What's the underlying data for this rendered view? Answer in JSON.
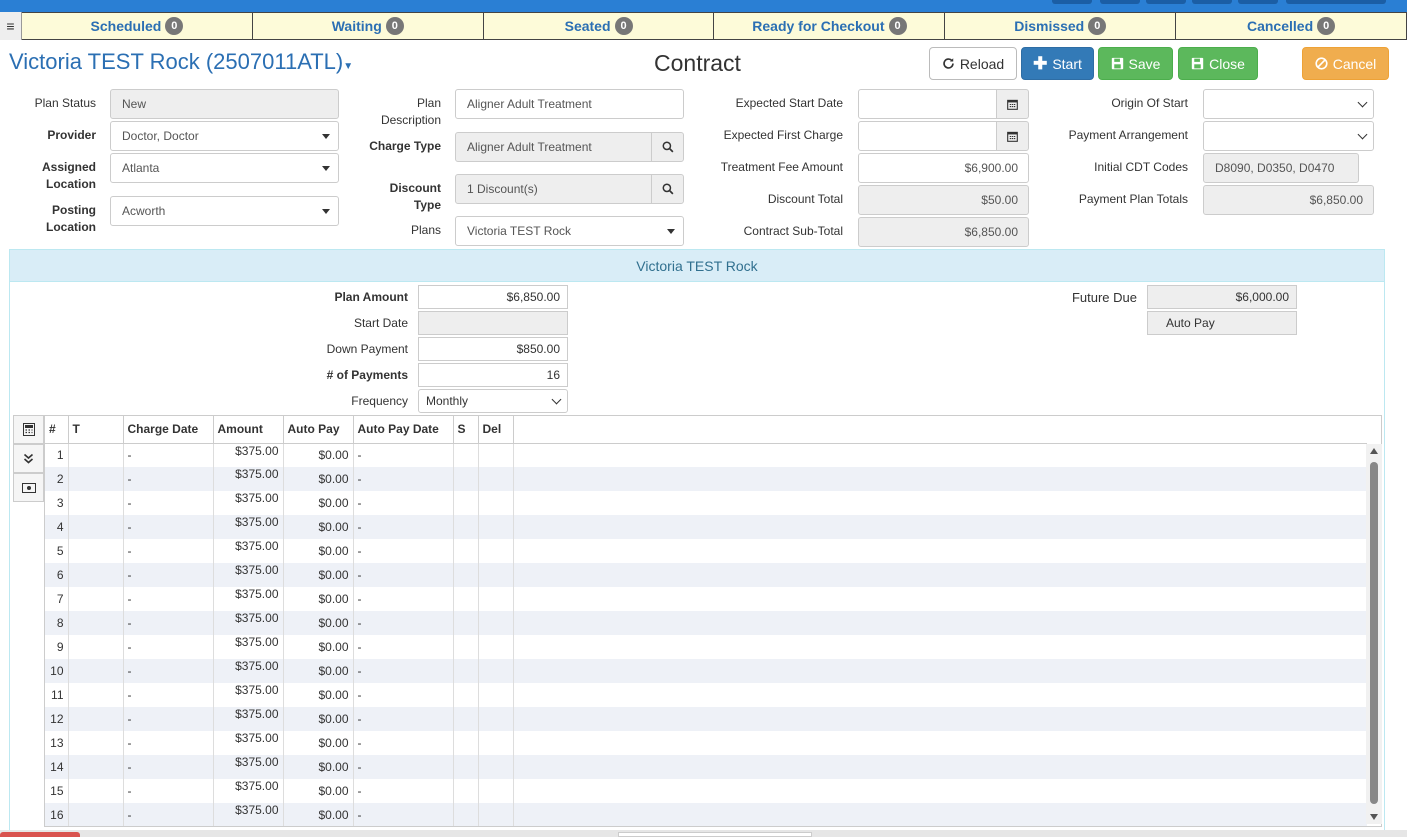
{
  "statusbar": {
    "tabs": [
      {
        "label": "Scheduled",
        "count": "0"
      },
      {
        "label": "Waiting",
        "count": "0"
      },
      {
        "label": "Seated",
        "count": "0"
      },
      {
        "label": "Ready for Checkout",
        "count": "0"
      },
      {
        "label": "Dismissed",
        "count": "0"
      },
      {
        "label": "Cancelled",
        "count": "0"
      }
    ]
  },
  "header": {
    "patient": "Victoria TEST Rock (2507011ATL)",
    "title": "Contract",
    "buttons": {
      "reload": "Reload",
      "start": "Start",
      "save": "Save",
      "close": "Close",
      "cancel": "Cancel"
    }
  },
  "form": {
    "plan_status": {
      "label": "Plan Status",
      "value": "New"
    },
    "provider": {
      "label": "Provider",
      "value": "Doctor, Doctor"
    },
    "assigned_location": {
      "label": "Assigned Location",
      "value": "Atlanta"
    },
    "posting_location": {
      "label": "Posting Location",
      "value": "Acworth"
    },
    "plan_description": {
      "label": "Plan Description",
      "value": "Aligner Adult Treatment"
    },
    "charge_type": {
      "label": "Charge Type",
      "value": "Aligner Adult Treatment"
    },
    "discount_type": {
      "label": "Discount Type",
      "value": "1 Discount(s)"
    },
    "plans": {
      "label": "Plans",
      "value": "Victoria TEST Rock"
    },
    "expected_start_date": {
      "label": "Expected Start Date",
      "value": ""
    },
    "expected_first_charge": {
      "label": "Expected First Charge",
      "value": ""
    },
    "treatment_fee_amount": {
      "label": "Treatment Fee Amount",
      "value": "$6,900.00"
    },
    "discount_total": {
      "label": "Discount Total",
      "value": "$50.00"
    },
    "contract_subtotal": {
      "label": "Contract Sub-Total",
      "value": "$6,850.00"
    },
    "origin_of_start": {
      "label": "Origin Of Start",
      "value": ""
    },
    "payment_arrangement": {
      "label": "Payment Arrangement",
      "value": ""
    },
    "initial_cdt_codes": {
      "label": "Initial CDT Codes",
      "value": "D8090, D0350, D0470"
    },
    "payment_plan_totals": {
      "label": "Payment Plan Totals",
      "value": "$6,850.00"
    }
  },
  "plan_panel": {
    "title": "Victoria TEST Rock",
    "plan_amount": {
      "label": "Plan Amount",
      "value": "$6,850.00"
    },
    "start_date": {
      "label": "Start Date",
      "value": ""
    },
    "down_payment": {
      "label": "Down Payment",
      "value": "$850.00"
    },
    "num_payments": {
      "label": "# of Payments",
      "value": "16"
    },
    "frequency": {
      "label": "Frequency",
      "value": "Monthly"
    },
    "future_due": {
      "label": "Future Due",
      "value": "$6,000.00"
    },
    "auto_pay_button": "Auto Pay"
  },
  "schedule": {
    "columns": [
      "#",
      "T",
      "Charge Date",
      "Amount",
      "Auto Pay",
      "Auto Pay Date",
      "S",
      "Del"
    ],
    "rows": [
      {
        "n": "1",
        "date": "-",
        "amount": "$375.00",
        "autopay": "$0.00",
        "apdate": "-"
      },
      {
        "n": "2",
        "date": "-",
        "amount": "$375.00",
        "autopay": "$0.00",
        "apdate": "-"
      },
      {
        "n": "3",
        "date": "-",
        "amount": "$375.00",
        "autopay": "$0.00",
        "apdate": "-"
      },
      {
        "n": "4",
        "date": "-",
        "amount": "$375.00",
        "autopay": "$0.00",
        "apdate": "-"
      },
      {
        "n": "5",
        "date": "-",
        "amount": "$375.00",
        "autopay": "$0.00",
        "apdate": "-"
      },
      {
        "n": "6",
        "date": "-",
        "amount": "$375.00",
        "autopay": "$0.00",
        "apdate": "-"
      },
      {
        "n": "7",
        "date": "-",
        "amount": "$375.00",
        "autopay": "$0.00",
        "apdate": "-"
      },
      {
        "n": "8",
        "date": "-",
        "amount": "$375.00",
        "autopay": "$0.00",
        "apdate": "-"
      },
      {
        "n": "9",
        "date": "-",
        "amount": "$375.00",
        "autopay": "$0.00",
        "apdate": "-"
      },
      {
        "n": "10",
        "date": "-",
        "amount": "$375.00",
        "autopay": "$0.00",
        "apdate": "-"
      },
      {
        "n": "11",
        "date": "-",
        "amount": "$375.00",
        "autopay": "$0.00",
        "apdate": "-"
      },
      {
        "n": "12",
        "date": "-",
        "amount": "$375.00",
        "autopay": "$0.00",
        "apdate": "-"
      },
      {
        "n": "13",
        "date": "-",
        "amount": "$375.00",
        "autopay": "$0.00",
        "apdate": "-"
      },
      {
        "n": "14",
        "date": "-",
        "amount": "$375.00",
        "autopay": "$0.00",
        "apdate": "-"
      },
      {
        "n": "15",
        "date": "-",
        "amount": "$375.00",
        "autopay": "$0.00",
        "apdate": "-"
      },
      {
        "n": "16",
        "date": "-",
        "amount": "$375.00",
        "autopay": "$0.00",
        "apdate": "-"
      }
    ]
  }
}
